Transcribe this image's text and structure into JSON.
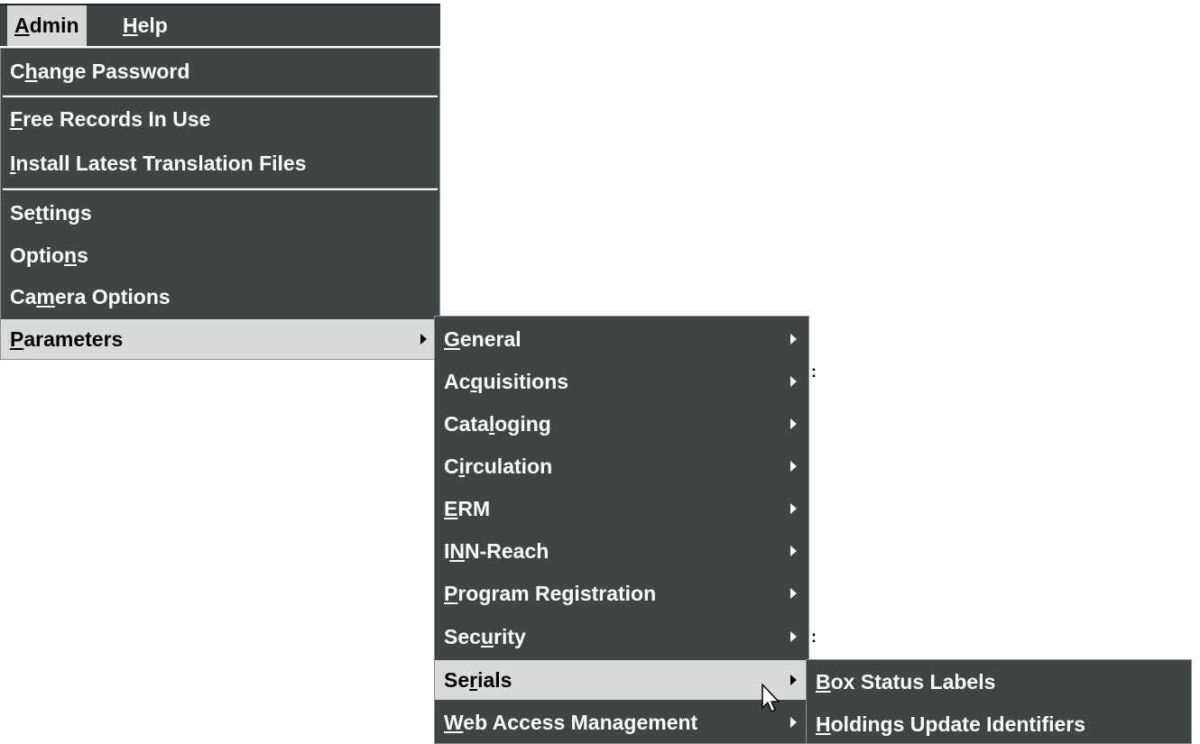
{
  "menubar": [
    {
      "pre": "",
      "u": "A",
      "post": "dmin"
    },
    {
      "pre": "",
      "u": "H",
      "post": "elp"
    }
  ],
  "admin_menu": [
    {
      "pre": "C",
      "u": "h",
      "post": "ange Password"
    },
    {
      "pre": "",
      "u": "F",
      "post": "ree Records In Use"
    },
    {
      "pre": "",
      "u": "I",
      "post": "nstall Latest Translation Files"
    },
    {
      "pre": "Se",
      "u": "t",
      "post": "tings"
    },
    {
      "pre": "Optio",
      "u": "n",
      "post": "s"
    },
    {
      "pre": "Ca",
      "u": "m",
      "post": "era Options"
    },
    {
      "pre": "",
      "u": "P",
      "post": "arameters"
    }
  ],
  "parameters_menu": [
    {
      "pre": "",
      "u": "G",
      "post": "eneral"
    },
    {
      "pre": "Ac",
      "u": "q",
      "post": "uisitions"
    },
    {
      "pre": "Cata",
      "u": "l",
      "post": "oging"
    },
    {
      "pre": "C",
      "u": "i",
      "post": "rculation"
    },
    {
      "pre": "",
      "u": "E",
      "post": "RM"
    },
    {
      "pre": "I",
      "u": "N",
      "post": "N-Reach"
    },
    {
      "pre": "",
      "u": "P",
      "post": "rogram Registration"
    },
    {
      "pre": "Sec",
      "u": "u",
      "post": "rity"
    },
    {
      "pre": "Se",
      "u": "r",
      "post": "ials"
    },
    {
      "pre": "",
      "u": "W",
      "post": "eb Access Management"
    }
  ],
  "serials_menu": [
    {
      "pre": "",
      "u": "B",
      "post": "ox Status Labels"
    },
    {
      "pre": "",
      "u": "H",
      "post": "oldings Update Identifiers"
    }
  ],
  "stray": {
    "colon_a": ":",
    "colon_b": ":"
  },
  "icons": {
    "submenu": "chevron-right-icon",
    "cursor": "mouse-pointer-icon"
  }
}
